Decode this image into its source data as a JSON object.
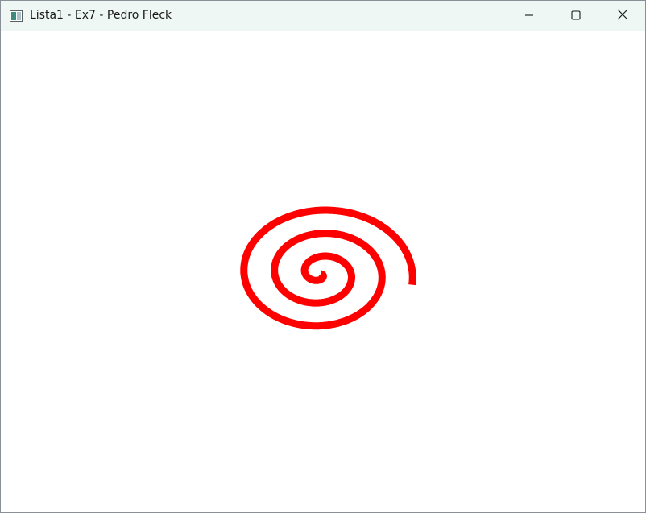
{
  "window": {
    "title": "Lista1 - Ex7 - Pedro Fleck",
    "app_icon": "app-window-icon",
    "controls": {
      "minimize_icon": "minimize-icon",
      "maximize_icon": "maximize-icon",
      "close_icon": "close-icon"
    }
  },
  "canvas": {
    "background": "#ffffff",
    "spiral_color": "#ff0000",
    "shape": "spiral"
  }
}
